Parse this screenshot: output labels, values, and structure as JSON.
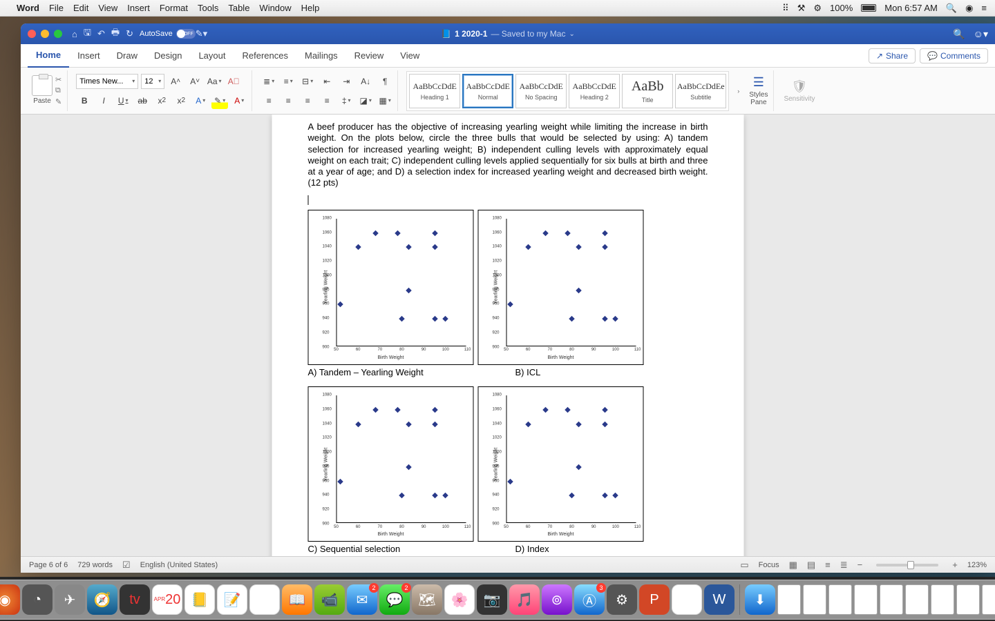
{
  "mac_menu": {
    "app": "Word",
    "items": [
      "File",
      "Edit",
      "View",
      "Insert",
      "Format",
      "Tools",
      "Table",
      "Window",
      "Help"
    ],
    "battery": "100%",
    "clock": "Mon 6:57 AM"
  },
  "titlebar": {
    "autosave": "AutoSave",
    "autosave_state": "OFF",
    "doc": "1 2020-1",
    "sub": "— Saved to my Mac"
  },
  "tabs": [
    "Home",
    "Insert",
    "Draw",
    "Design",
    "Layout",
    "References",
    "Mailings",
    "Review",
    "View"
  ],
  "share": "Share",
  "comments": "Comments",
  "font": {
    "name": "Times New...",
    "size": "12"
  },
  "paste": "Paste",
  "styles_gal": [
    {
      "prev": "AaBbCcDdE",
      "lbl": "Heading 1"
    },
    {
      "prev": "AaBbCcDdE",
      "lbl": "Normal",
      "sel": true
    },
    {
      "prev": "AaBbCcDdE",
      "lbl": "No Spacing"
    },
    {
      "prev": "AaBbCcDdE",
      "lbl": "Heading 2"
    },
    {
      "prev": "AaBb",
      "lbl": "Title",
      "big": true
    },
    {
      "prev": "AaBbCcDdEe",
      "lbl": "Subtitle"
    }
  ],
  "styles_pane": "Styles\nPane",
  "sensitivity": "Sensitivity",
  "paragraph_text": "A beef producer has the objective of increasing yearling weight while limiting the increase in birth weight.  On the plots below, circle the three bulls that would be selected by using: A) tandem selection for increased yearling weight; B) independent culling levels with approximately equal weight on each trait; C) independent culling levels applied sequentially for six bulls at birth and three at a year of age; and D) a selection index for increased yearling weight and decreased birth weight. (12 pts)",
  "captions": {
    "a": "A) Tandem – Yearling Weight",
    "b": "B) ICL",
    "c": "C) Sequential selection",
    "d": "D) Index"
  },
  "status": {
    "page": "Page 6 of 6",
    "words": "729 words",
    "lang": "English (United States)",
    "focus": "Focus",
    "zoom": "123%"
  },
  "dock_badges": {
    "mail": "2",
    "msg": "2",
    "app": "3"
  },
  "chart_data": {
    "type": "scatter",
    "xlabel": "Birth Weight",
    "ylabel": "Yearling Weight",
    "xlim": [
      50,
      110
    ],
    "ylim": [
      900,
      1080
    ],
    "xticks": [
      50,
      60,
      70,
      80,
      90,
      100,
      110
    ],
    "yticks": [
      900,
      920,
      940,
      960,
      980,
      1000,
      1020,
      1040,
      1060,
      1080
    ],
    "points": [
      {
        "x": 52,
        "y": 960
      },
      {
        "x": 60,
        "y": 1040
      },
      {
        "x": 68,
        "y": 1060
      },
      {
        "x": 78,
        "y": 1060
      },
      {
        "x": 80,
        "y": 940
      },
      {
        "x": 83,
        "y": 1040
      },
      {
        "x": 83,
        "y": 980
      },
      {
        "x": 95,
        "y": 1060
      },
      {
        "x": 95,
        "y": 1040
      },
      {
        "x": 95,
        "y": 940
      },
      {
        "x": 100,
        "y": 940
      }
    ],
    "note": "All four panels (A–D) show the same scatter data."
  }
}
